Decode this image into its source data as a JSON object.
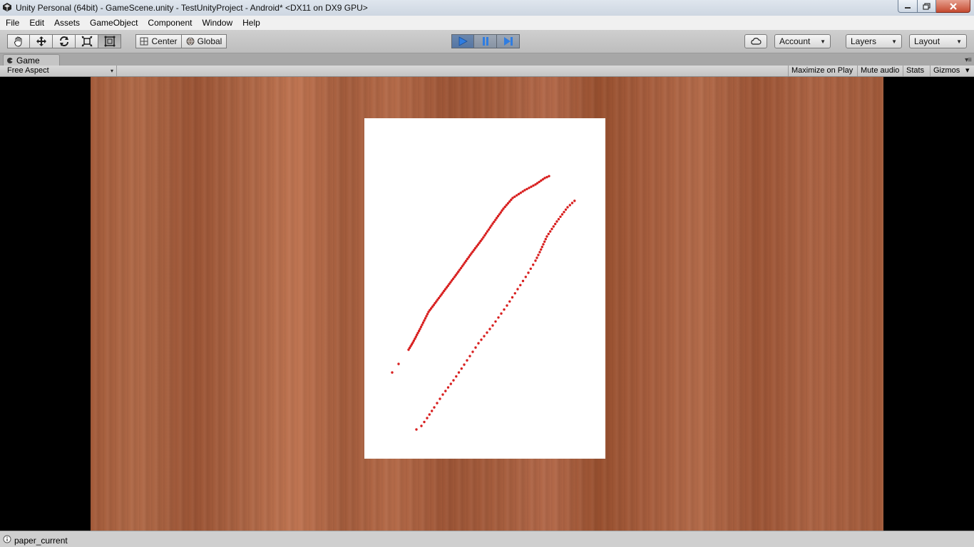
{
  "window": {
    "title": "Unity Personal (64bit) - GameScene.unity - TestUnityProject - Android* <DX11 on DX9 GPU>"
  },
  "menubar": {
    "items": [
      "File",
      "Edit",
      "Assets",
      "GameObject",
      "Component",
      "Window",
      "Help"
    ]
  },
  "toolbar": {
    "tools": [
      "hand-tool-icon",
      "move-tool-icon",
      "rotate-tool-icon",
      "scale-tool-icon",
      "rect-tool-icon"
    ],
    "pivot_label": "Center",
    "space_label": "Global",
    "play_state": "playing",
    "account_label": "Account",
    "layers_label": "Layers",
    "layout_label": "Layout"
  },
  "game_view": {
    "tab_label": "Game",
    "aspect": "Free Aspect",
    "maximize_label": "Maximize on Play",
    "mute_label": "Mute audio",
    "stats_label": "Stats",
    "gizmos_label": "Gizmos"
  },
  "scene": {
    "stroke_color": "#d81f1f",
    "paper_color": "#ffffff",
    "wood_color": "#a65e3e"
  },
  "statusbar": {
    "message": "paper_current"
  }
}
